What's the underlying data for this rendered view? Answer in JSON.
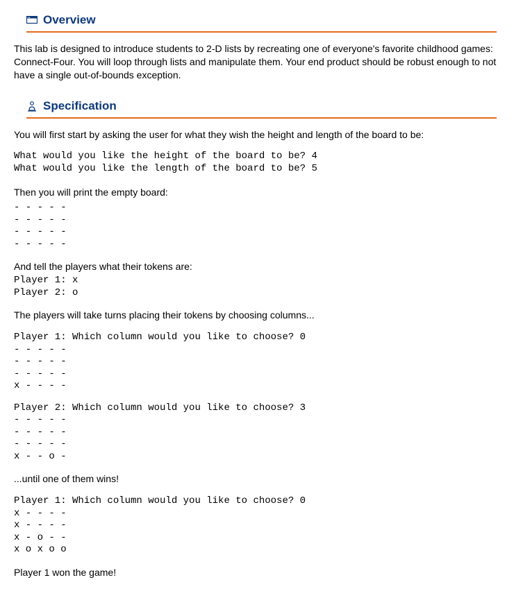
{
  "sections": {
    "overview": {
      "title": "Overview",
      "paragraph": "This lab is designed to introduce students to 2-D lists by recreating one of everyone's favorite childhood games: Connect-Four. You will loop through lists and manipulate them. Your end product should be robust enough to not have a single out-of-bounds exception."
    },
    "specification": {
      "title": "Specification",
      "intro": "You will first start by asking the user for what they wish the height and length of the board to be:",
      "prompt_hw": "What would you like the height of the board to be? 4\nWhat would you like the length of the board to be? 5",
      "print_empty": "Then you will print the empty board:",
      "empty_board": "- - - - -\n- - - - -\n- - - - -\n- - - - -",
      "tokens_intro": "And tell the players what their tokens are:",
      "tokens": "Player 1: x\nPlayer 2: o",
      "take_turns": "The players will take turns placing their tokens by choosing columns...",
      "turn1": "Player 1: Which column would you like to choose? 0\n- - - - -\n- - - - -\n- - - - -\nx - - - -",
      "turn2": "Player 2: Which column would you like to choose? 3\n- - - - -\n- - - - -\n- - - - -\nx - - o -",
      "until_win": "...until one of them wins!",
      "final": "Player 1: Which column would you like to choose? 0\nx - - - -\nx - - - -\nx - o - -\nx o x o o",
      "winner": "Player 1 won the game!"
    }
  }
}
